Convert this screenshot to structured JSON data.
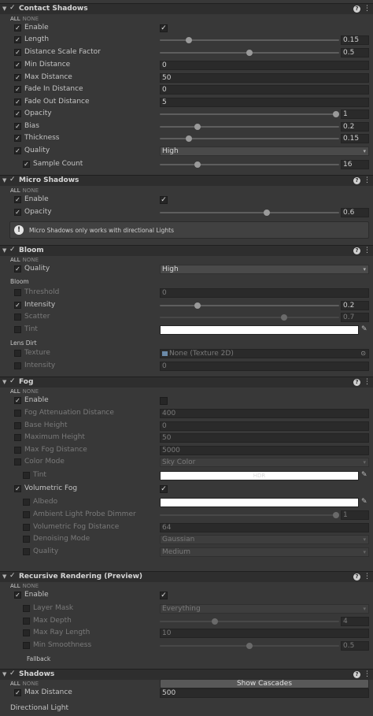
{
  "common": {
    "all": "ALL",
    "none": "NONE",
    "check": "✓",
    "help": "?",
    "menu": "⋮",
    "fold": "▼",
    "arrow": "▾",
    "eyedropper": "✎",
    "picker": "⊙"
  },
  "contact_shadows": {
    "title": "Contact Shadows",
    "rows": {
      "enable": "Enable",
      "length": {
        "label": "Length",
        "value": "0.15",
        "fraction": 0.15
      },
      "distance_scale": {
        "label": "Distance Scale Factor",
        "value": "0.5",
        "fraction": 0.5
      },
      "min_distance": {
        "label": "Min Distance",
        "value": "0"
      },
      "max_distance": {
        "label": "Max Distance",
        "value": "50"
      },
      "fade_in": {
        "label": "Fade In Distance",
        "value": "0"
      },
      "fade_out": {
        "label": "Fade Out Distance",
        "value": "5"
      },
      "opacity": {
        "label": "Opacity",
        "value": "1",
        "fraction": 1.0
      },
      "bias": {
        "label": "Bias",
        "value": "0.2",
        "fraction": 0.2
      },
      "thickness": {
        "label": "Thickness",
        "value": "0.15",
        "fraction": 0.15
      },
      "quality": {
        "label": "Quality",
        "value": "High"
      },
      "sample_count": {
        "label": "Sample Count",
        "value": "16",
        "fraction": 0.2
      }
    }
  },
  "micro_shadows": {
    "title": "Micro Shadows",
    "enable": "Enable",
    "opacity": {
      "label": "Opacity",
      "value": "0.6",
      "fraction": 0.6
    },
    "help": "Micro Shadows only works with directional Lights"
  },
  "bloom": {
    "title": "Bloom",
    "quality": {
      "label": "Quality",
      "value": "High"
    },
    "section_bloom": "Bloom",
    "threshold": {
      "label": "Threshold",
      "value": "0"
    },
    "intensity": {
      "label": "Intensity",
      "value": "0.2",
      "fraction": 0.2
    },
    "scatter": {
      "label": "Scatter",
      "value": "0.7",
      "fraction": 0.7
    },
    "tint": {
      "label": "Tint"
    },
    "section_lens_dirt": "Lens Dirt",
    "texture": {
      "label": "Texture",
      "value": "None (Texture 2D)"
    },
    "dirt_intensity": {
      "label": "Intensity",
      "value": "0"
    }
  },
  "fog": {
    "title": "Fog",
    "enable": "Enable",
    "attenuation": {
      "label": "Fog Attenuation Distance",
      "value": "400"
    },
    "base_height": {
      "label": "Base Height",
      "value": "0"
    },
    "max_height": {
      "label": "Maximum Height",
      "value": "50"
    },
    "max_fog_distance": {
      "label": "Max Fog Distance",
      "value": "5000"
    },
    "color_mode": {
      "label": "Color Mode",
      "value": "Sky Color"
    },
    "tint": {
      "label": "Tint",
      "badge": "HDR"
    },
    "volumetric": "Volumetric Fog",
    "albedo": {
      "label": "Albedo"
    },
    "probe_dimmer": {
      "label": "Ambient Light Probe Dimmer",
      "value": "1",
      "fraction": 1.0
    },
    "vol_distance": {
      "label": "Volumetric Fog Distance",
      "value": "64"
    },
    "denoising": {
      "label": "Denoising Mode",
      "value": "Gaussian"
    },
    "quality": {
      "label": "Quality",
      "value": "Medium"
    }
  },
  "recursive": {
    "title": "Recursive Rendering (Preview)",
    "enable": "Enable",
    "layer_mask": {
      "label": "Layer Mask",
      "value": "Everything"
    },
    "max_depth": {
      "label": "Max Depth",
      "value": "4",
      "fraction": 0.3
    },
    "max_ray_length": {
      "label": "Max Ray Length",
      "value": "10"
    },
    "min_smoothness": {
      "label": "Min Smoothness",
      "value": "0.5",
      "fraction": 0.5
    },
    "fallback": "Fallback"
  },
  "shadows": {
    "title": "Shadows",
    "show_cascades": "Show Cascades",
    "max_distance": {
      "label": "Max Distance",
      "value": "500"
    },
    "directional_light": "Directional Light"
  },
  "colors": {
    "panel_bg": "#383838",
    "header_bg": "#2e2e2e",
    "field_bg": "#2a2a2a"
  }
}
